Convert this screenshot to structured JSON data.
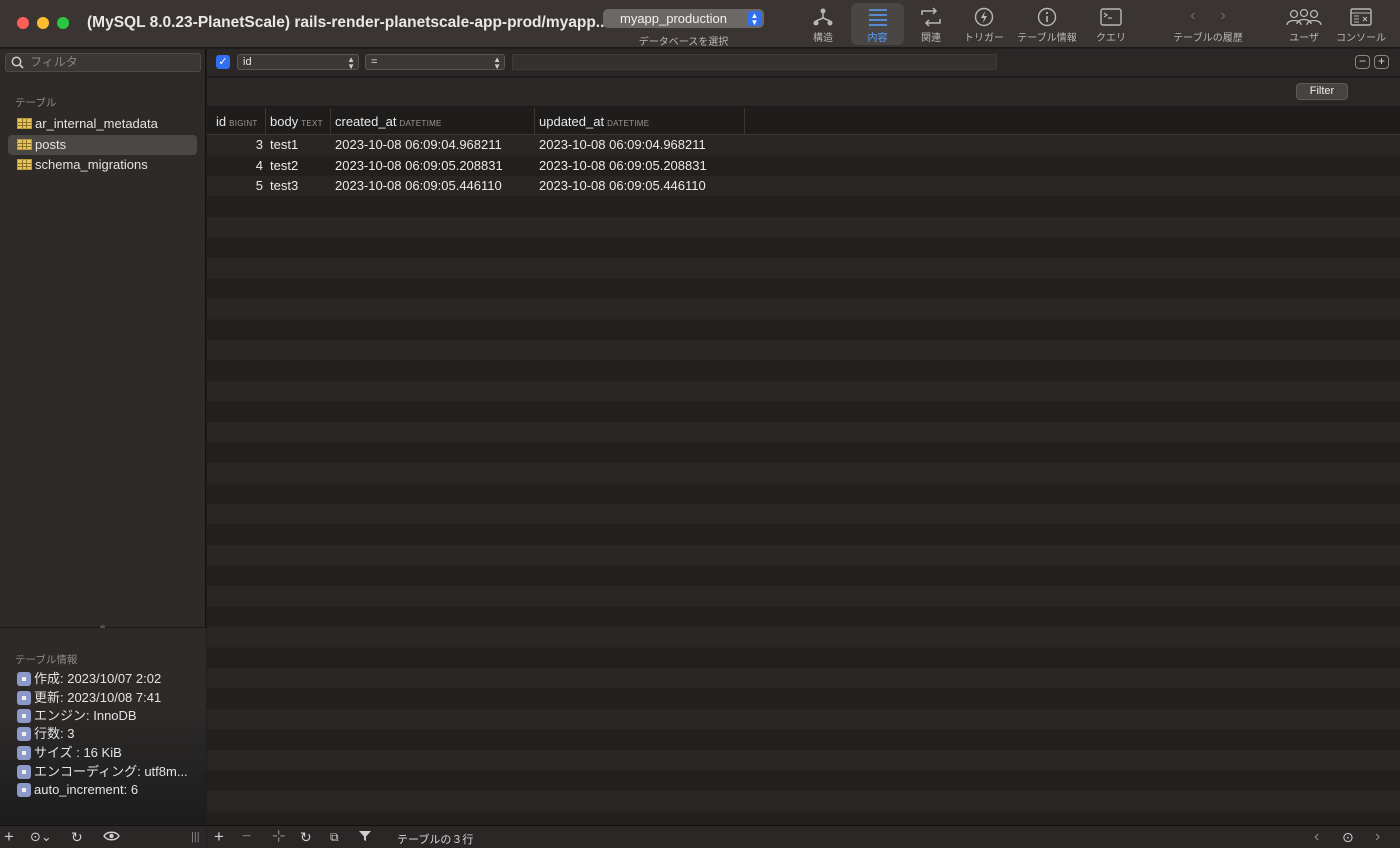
{
  "window": {
    "title": "(MySQL 8.0.23-PlanetScale) rails-render-planetscale-app-prod/myapp...",
    "database": "myapp_production",
    "database_caption": "データベースを選択"
  },
  "toolbar": {
    "structure": "構造",
    "content": "内容",
    "relations": "関連",
    "triggers": "トリガー",
    "table_info": "テーブル情報",
    "query": "クエリ",
    "history": "テーブルの履歴",
    "users": "ユーザ",
    "console": "コンソール"
  },
  "sidebar": {
    "filter_placeholder": "フィルタ",
    "tables_label": "テーブル",
    "tables": [
      "ar_internal_metadata",
      "posts",
      "schema_migrations"
    ],
    "selected_table": "posts",
    "info_label": "テーブル情報",
    "info": [
      "作成: 2023/10/07 2:02",
      "更新: 2023/10/08 7:41",
      "エンジン: InnoDB",
      "行数: 3",
      "サイズ : 16 KiB",
      "エンコーディング: utf8m...",
      "auto_increment: 6"
    ]
  },
  "filter": {
    "enabled": true,
    "field": "id",
    "operator": "=",
    "value": "",
    "button": "Filter"
  },
  "grid": {
    "columns": [
      {
        "name": "id",
        "type": "BIGINT"
      },
      {
        "name": "body",
        "type": "TEXT"
      },
      {
        "name": "created_at",
        "type": "DATETIME"
      },
      {
        "name": "updated_at",
        "type": "DATETIME"
      }
    ],
    "rows": [
      {
        "id": "3",
        "body": "test1",
        "created_at": "2023-10-08 06:09:04.968211",
        "updated_at": "2023-10-08 06:09:04.968211"
      },
      {
        "id": "4",
        "body": "test2",
        "created_at": "2023-10-08 06:09:05.208831",
        "updated_at": "2023-10-08 06:09:05.208831"
      },
      {
        "id": "5",
        "body": "test3",
        "created_at": "2023-10-08 06:09:05.446110",
        "updated_at": "2023-10-08 06:09:05.446110"
      }
    ]
  },
  "status": {
    "row_count": "テーブルの３行"
  },
  "colors": {
    "accent": "#2f6ff0",
    "active_tab": "#5aa2ff",
    "table_icon": "#e7c55c"
  }
}
